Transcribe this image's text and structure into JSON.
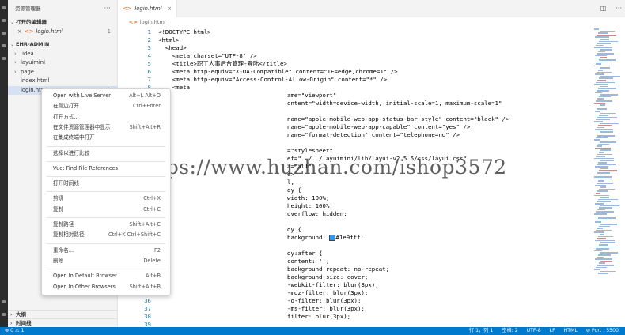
{
  "sidebar": {
    "title": "资源管理器",
    "more": "···",
    "open_editors_section": "打开的编辑器",
    "open_editor_file": "login.html",
    "open_editor_badge": "1",
    "project_section": "EHR-ADMIN",
    "tree": [
      {
        "label": ".idea",
        "type": "folder"
      },
      {
        "label": "layuimini",
        "type": "folder"
      },
      {
        "label": "page",
        "type": "folder"
      },
      {
        "label": "index.html",
        "type": "file"
      },
      {
        "label": "login.html",
        "type": "file",
        "badge": "1"
      }
    ],
    "outline_section": "大纲",
    "timeline_section": "时间线"
  },
  "tab": {
    "label": "login.html",
    "icon": "<>",
    "close": "×"
  },
  "breadcrumb": {
    "icon": "<>",
    "label": "login.html"
  },
  "code_lines": [
    {
      "n": "1",
      "text": "<!DOCTYPE html>"
    },
    {
      "n": "2",
      "text": "<html>"
    },
    {
      "n": "3",
      "text": "  <head>"
    },
    {
      "n": "4",
      "text": "    <meta charset=\"UTF-8\" />"
    },
    {
      "n": "5",
      "text": "    <title>职工人事后台管理-登陆</title>"
    },
    {
      "n": "6",
      "text": "    <meta http-equiv=\"X-UA-Compatible\" content=\"IE=edge,chrome=1\" />"
    },
    {
      "n": "7",
      "text": "    <meta http-equiv=\"Access-Control-Allow-Origin\" content=\"*\" />"
    },
    {
      "n": "8",
      "text": "    <meta"
    },
    {
      "n": "",
      "text": "ame=\"viewport\""
    },
    {
      "n": "",
      "text": "ontent=\"width=device-width, initial-scale=1, maximum-scale=1\""
    },
    {
      "n": "",
      "text": ""
    },
    {
      "n": "",
      "text": "name=\"apple-mobile-web-app-status-bar-style\" content=\"black\" />"
    },
    {
      "n": "",
      "text": "name=\"apple-mobile-web-app-capable\" content=\"yes\" />"
    },
    {
      "n": "",
      "text": "name=\"format-detection\" content=\"telephone=no\" />"
    },
    {
      "n": "",
      "text": ""
    },
    {
      "n": "",
      "text": "=\"stylesheet\""
    },
    {
      "n": "",
      "text": "ef=\"../../layuimini/lib/layui-v2.5.5/css/layui.css\""
    },
    {
      "n": "",
      "text": "a=\"all\""
    },
    {
      "n": "",
      "text": "e>"
    },
    {
      "n": "",
      "text": "l,"
    },
    {
      "n": "",
      "text": "dy {"
    },
    {
      "n": "",
      "text": "width: 100%;"
    },
    {
      "n": "",
      "text": "height: 100%;"
    },
    {
      "n": "",
      "text": "overflow: hidden;"
    },
    {
      "n": "",
      "text": ""
    },
    {
      "n": "",
      "text": "dy {"
    },
    {
      "n": "",
      "text": "background: ■#1e9fff;"
    },
    {
      "n": "",
      "text": ""
    },
    {
      "n": "",
      "text": "dy:after {"
    },
    {
      "n": "",
      "text": "content: '';"
    },
    {
      "n": "",
      "text": "background-repeat: no-repeat;"
    },
    {
      "n": "",
      "text": "background-size: cover;"
    },
    {
      "n": "",
      "text": "-webkit-filter: blur(3px);"
    },
    {
      "n": "35",
      "text": "-moz-filter: blur(3px);"
    },
    {
      "n": "36",
      "text": "-o-filter: blur(3px);"
    },
    {
      "n": "37",
      "text": "-ms-filter: blur(3px);"
    },
    {
      "n": "38",
      "text": "filter: blur(3px);"
    },
    {
      "n": "39",
      "text": ""
    }
  ],
  "watermark": "https://www.huzhan.com/ishop3572",
  "context_menu": {
    "groups": [
      [
        {
          "label": "Open with Live Server",
          "shortcut": "Alt+L Alt+O"
        },
        {
          "label": "在侧边打开",
          "shortcut": "Ctrl+Enter"
        },
        {
          "label": "打开方式...",
          "shortcut": ""
        },
        {
          "label": "在文件资源管理器中显示",
          "shortcut": "Shift+Alt+R"
        },
        {
          "label": "在集成终端中打开",
          "shortcut": ""
        }
      ],
      [
        {
          "label": "选择以进行比较",
          "shortcut": ""
        }
      ],
      [
        {
          "label": "Vue: Find File References",
          "shortcut": ""
        }
      ],
      [
        {
          "label": "打开时间线",
          "shortcut": ""
        }
      ],
      [
        {
          "label": "剪切",
          "shortcut": "Ctrl+X"
        },
        {
          "label": "复制",
          "shortcut": "Ctrl+C"
        }
      ],
      [
        {
          "label": "复制路径",
          "shortcut": "Shift+Alt+C"
        },
        {
          "label": "复制相对路径",
          "shortcut": "Ctrl+K Ctrl+Shift+C"
        }
      ],
      [
        {
          "label": "重命名...",
          "shortcut": "F2"
        },
        {
          "label": "删除",
          "shortcut": "Delete"
        }
      ],
      [
        {
          "label": "Open In Default Browser",
          "shortcut": "Alt+B"
        },
        {
          "label": "Open In Other Browsers",
          "shortcut": "Shift+Alt+B"
        }
      ]
    ]
  },
  "status_bar": {
    "left": "⊗ 0 ⚠ 1",
    "position": "行 1，列 1",
    "spaces": "空格: 2",
    "encoding": "UTF-8",
    "eol": "LF",
    "language": "HTML",
    "port": "⊘ Port : 5500",
    "accent": "#007acc"
  }
}
